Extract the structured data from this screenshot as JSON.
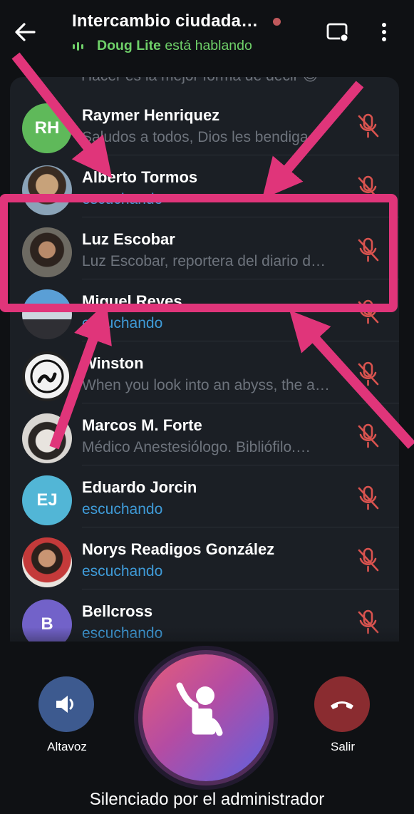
{
  "header": {
    "title": "Intercambio ciudada…",
    "speaking_name": "Doug Lite",
    "speaking_suffix": " está hablando",
    "speaking_color": "#6fd069",
    "record_dot_color": "#c0595c"
  },
  "list_peek_text": "Hacer es la mejor forma de decir 😊",
  "participants": [
    {
      "name": "Raymer Henriquez",
      "status": "Saludos a todos, Dios les bendiga.",
      "avatar": "RH",
      "avatar_color": "#5fb95a",
      "listening": false
    },
    {
      "name": "Alberto Tormos",
      "status": "escuchando",
      "avatar": "photo",
      "listening": true
    },
    {
      "name": "Luz Escobar",
      "status": "Luz Escobar, reportera del diario d…",
      "avatar": "photo",
      "listening": false
    },
    {
      "name": "Miguel Reyes",
      "status": "escuchando",
      "avatar": "photo",
      "listening": true
    },
    {
      "name": "Winston",
      "status": "When you look into an abyss, the a…",
      "avatar": "photo",
      "listening": false
    },
    {
      "name": "Marcos M. Forte",
      "status": "Médico Anestesiólogo. Bibliófilo.…",
      "avatar": "photo",
      "listening": false
    },
    {
      "name": "Eduardo Jorcin",
      "status": "escuchando",
      "avatar": "EJ",
      "avatar_color": "#52b6d6",
      "listening": true
    },
    {
      "name": "Norys Readigos González",
      "status": "escuchando",
      "avatar": "photo",
      "listening": true
    },
    {
      "name": "Bellcross",
      "status": "escuchando",
      "avatar": "B",
      "avatar_color": "#7262c9",
      "listening": true
    }
  ],
  "controls": {
    "speaker_label": "Altavoz",
    "leave_label": "Salir",
    "muted_caption": "Silenciado por el administrador",
    "speaker_color": "#3d5a8f",
    "leave_color": "#8a2c30",
    "muted_icon_color": "#d9534f"
  },
  "annotation_color": "#e0357a",
  "icons": [
    "back-arrow-icon",
    "screen-share-icon",
    "more-icon",
    "mic-off-icon",
    "speaker-icon",
    "raise-hand-icon",
    "hang-up-icon"
  ]
}
